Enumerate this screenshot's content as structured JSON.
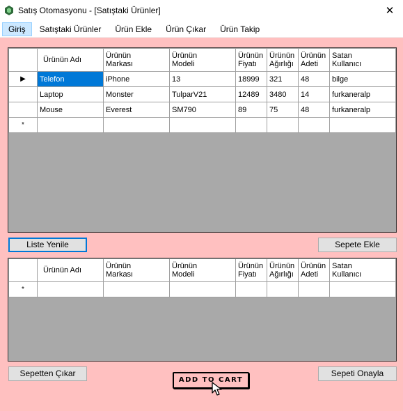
{
  "window": {
    "title": "Satış Otomasyonu - [Satıştaki Ürünler]",
    "close_label": "✕"
  },
  "menu": {
    "items": [
      {
        "label": "Giriş"
      },
      {
        "label": "Satıştaki Ürünler"
      },
      {
        "label": "Ürün Ekle"
      },
      {
        "label": "Ürün Çıkar"
      },
      {
        "label": "Ürün Takip"
      }
    ]
  },
  "columns": [
    {
      "l1": "Ürünün Adı",
      "l2": ""
    },
    {
      "l1": "Ürünün",
      "l2": "Markası"
    },
    {
      "l1": "Ürünün",
      "l2": "Modeli"
    },
    {
      "l1": "Ürünün",
      "l2": "Fiyatı"
    },
    {
      "l1": "Ürünün",
      "l2": "Ağırlığı"
    },
    {
      "l1": "Ürünün",
      "l2": "Adeti"
    },
    {
      "l1": "Satan",
      "l2": "Kullanıcı"
    }
  ],
  "products_grid": {
    "current_row_marker": "▶",
    "new_row_marker": "*",
    "rows": [
      [
        "Telefon",
        "iPhone",
        "13",
        "18999",
        "321",
        "48",
        "bilge"
      ],
      [
        "Laptop",
        "Monster",
        "TulparV21",
        "12489",
        "3480",
        "14",
        "furkaneralp"
      ],
      [
        "Mouse",
        "Everest",
        "SM790",
        "89",
        "75",
        "48",
        "furkaneralp"
      ]
    ]
  },
  "cart_grid": {
    "new_row_marker": "*"
  },
  "buttons": {
    "refresh": "Liste Yenile",
    "add_to_cart": "Sepete Ekle",
    "remove_from_cart": "Sepetten Çıkar",
    "confirm_cart": "Sepeti Onayla",
    "add_to_cart_image_text": "ADD TO CART"
  },
  "colors": {
    "background": "#ffc0c0",
    "selection": "#0078d7",
    "grid_empty": "#a9a9a9"
  }
}
